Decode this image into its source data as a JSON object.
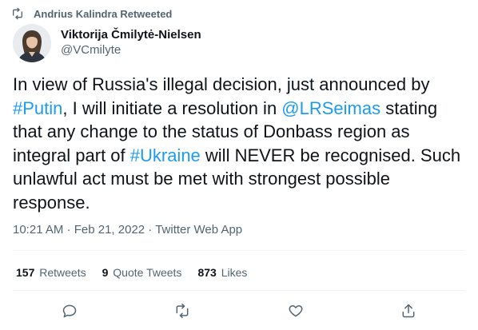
{
  "retweet_context": {
    "text": "Andrius Kalindra Retweeted"
  },
  "author": {
    "name": "Viktorija Čmilytė-Nielsen",
    "handle": "@VCmilyte"
  },
  "tweet": {
    "segments": [
      {
        "text": "In view of Russia's illegal decision, just announced by ",
        "link": false
      },
      {
        "text": "#Putin",
        "link": true
      },
      {
        "text": ", I will initiate a resolution in ",
        "link": false
      },
      {
        "text": "@LRSeimas",
        "link": true
      },
      {
        "text": " stating that any change to the status of Donbass region as integral part of ",
        "link": false
      },
      {
        "text": "#Ukraine",
        "link": true
      },
      {
        "text": " will NEVER be recognised. Such unlawful act must be met with strongest possible response.",
        "link": false
      }
    ]
  },
  "meta": {
    "time": "10:21 AM",
    "separator": " · ",
    "date": "Feb 21, 2022",
    "source": "Twitter Web App"
  },
  "stats": {
    "retweets": {
      "count": "157",
      "label": "Retweets"
    },
    "quote_tweets": {
      "count": "9",
      "label": "Quote Tweets"
    },
    "likes": {
      "count": "873",
      "label": "Likes"
    }
  },
  "actions": [
    "reply-icon",
    "retweet-icon",
    "like-icon",
    "share-icon"
  ],
  "colors": {
    "link": "#1d9bf0",
    "secondary": "#536471",
    "text": "#0f1419",
    "divider": "#eff3f4"
  }
}
